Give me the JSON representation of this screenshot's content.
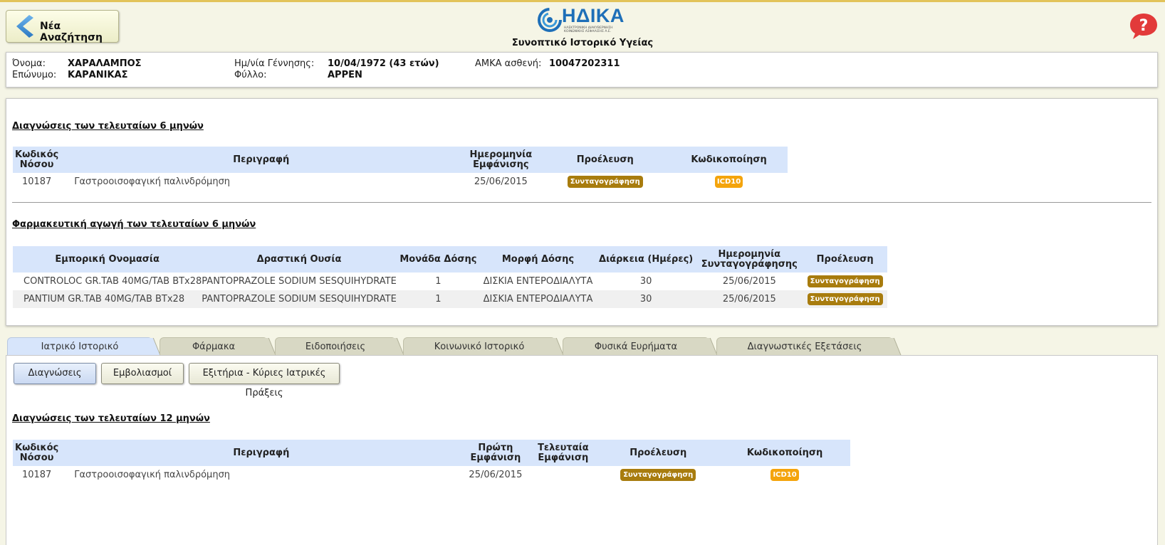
{
  "header": {
    "back_label": "Νέα Αναζήτηση",
    "logo_text": "ΗΔΙΚΑ",
    "logo_sub": "ΗΛΕΚΤΡΟΝΙΚΗ ΔΙΑΚΥΒΕΡΝΗΣΗ ΚΟΙΝΩΝΙΚΗΣ ΑΣΦΑΛΙΣΗΣ Α.Ε.",
    "title": "Συνοπτικό Ιστορικό Υγείας",
    "help_glyph": "?"
  },
  "patient": {
    "first_name_label": "Όνομα:",
    "first_name": "ΧΑΡΑΛΑΜΠΟΣ",
    "last_name_label": "Επώνυμο:",
    "last_name": "ΚΑΡΑΝΙΚΑΣ",
    "dob_label": "Ημ/νία Γέννησης:",
    "dob": "10/04/1972 (43 ετών)",
    "sex_label": "Φύλλο:",
    "sex": "ΑΡΡΕΝ",
    "amka_label": "ΑΜΚΑ ασθενή:",
    "amka": "10047202311"
  },
  "diagnoses6": {
    "title": "Διαγνώσεις των τελευταίων 6 μηνών",
    "headers": {
      "code": "Κωδικός Νόσου",
      "description": "Περιγραφή",
      "date": "Ημερομηνία Εμφάνισης",
      "origin": "Προέλευση",
      "coding": "Κωδικοποίηση"
    },
    "rows": [
      {
        "code": "10187",
        "description": "Γαστροοισοφαγική παλινδρόμηση",
        "date": "25/06/2015",
        "origin": "Συνταγογράφηση",
        "coding": "ICD10"
      }
    ]
  },
  "meds6": {
    "title": "Φαρμακευτική αγωγή των τελευταίων 6 μηνών",
    "headers": {
      "trade_name": "Εμπορική Ονομασία",
      "substance": "Δραστική Ουσία",
      "dose_unit": "Μονάδα Δόσης",
      "dose_form": "Μορφή Δόσης",
      "duration": "Διάρκεια (Ημέρες)",
      "rx_date": "Ημερομηνία Συνταγογράφησης",
      "origin": "Προέλευση"
    },
    "rows": [
      {
        "trade_name": "CONTROLOC GR.TAB 40MG/TAB BTx28",
        "substance": "PANTOPRAZOLE SODIUM SESQUIHYDRATE",
        "dose_unit": "1",
        "dose_form": "ΔΙΣΚΙΑ ΕΝΤΕΡΟΔΙΑΛΥΤΑ",
        "duration": "30",
        "rx_date": "25/06/2015",
        "origin": "Συνταγογράφηση"
      },
      {
        "trade_name": "PANTIUM GR.TAB 40MG/TAB BTx28",
        "substance": "PANTOPRAZOLE SODIUM SESQUIHYDRATE",
        "dose_unit": "1",
        "dose_form": "ΔΙΣΚΙΑ ΕΝΤΕΡΟΔΙΑΛΥΤΑ",
        "duration": "30",
        "rx_date": "25/06/2015",
        "origin": "Συνταγογράφηση"
      }
    ]
  },
  "tabs": [
    {
      "label": "Ιατρικό Ιστορικό",
      "active": true
    },
    {
      "label": "Φάρμακα"
    },
    {
      "label": "Ειδοποιήσεις"
    },
    {
      "label": "Κοινωνικό Ιστορικό"
    },
    {
      "label": "Φυσικά Ευρήματα"
    },
    {
      "label": "Διαγνωστικές Εξετάσεις"
    }
  ],
  "subtabs": [
    {
      "label": "Διαγνώσεις",
      "active": true
    },
    {
      "label": "Εμβολιασμοί"
    },
    {
      "label": "Εξιτήρια - Κύριες Ιατρικές Πράξεις"
    }
  ],
  "diagnoses12": {
    "title": "Διαγνώσεις των τελευταίων 12 μηνών",
    "headers": {
      "code": "Κωδικός Νόσου",
      "description": "Περιγραφή",
      "first": "Πρώτη Εμφάνιση",
      "last": "Τελευταία Εμφάνιση",
      "origin": "Προέλευση",
      "coding": "Κωδικοποίηση"
    },
    "rows": [
      {
        "code": "10187",
        "description": "Γαστροοισοφαγική παλινδρόμηση",
        "first": "25/06/2015",
        "last": "",
        "origin": "Συνταγογράφηση",
        "coding": "ICD10"
      }
    ]
  },
  "colors": {
    "origin_badge": "#a87c0e",
    "icd_badge": "#f4a40c",
    "table_header": "#d7e5fb",
    "page_bg": "#f5f5e6"
  }
}
